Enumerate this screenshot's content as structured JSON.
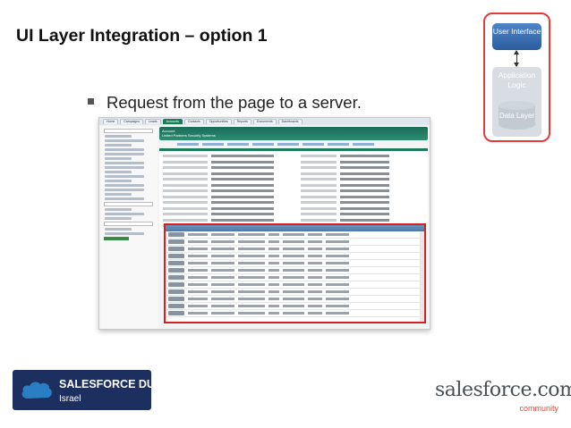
{
  "slide": {
    "title": "UI Layer Integration – option 1",
    "bullet": "Request from the page to a server."
  },
  "diagram": {
    "ui_layer": "User Interface",
    "app_layer": "Application Logic",
    "data_layer": "Data Layer",
    "accent_color": "#e23b3b",
    "ui_color": "#2c5d9d"
  },
  "screenshot": {
    "tabs": [
      "Home",
      "Campaigns",
      "Leads",
      "Accounts",
      "Contacts",
      "Opportunities",
      "Reports",
      "Documents",
      "Dashboards"
    ],
    "active_tab_index": 3,
    "account_header": "Account",
    "account_name": "United Partners Security Systems",
    "highlight_color": "#d42020"
  },
  "logos": {
    "dug_line1": "SALESFORCE DUG",
    "dug_line2": "Israel",
    "sfc_line1": "salesforce.com",
    "sfc_line2": "community"
  }
}
